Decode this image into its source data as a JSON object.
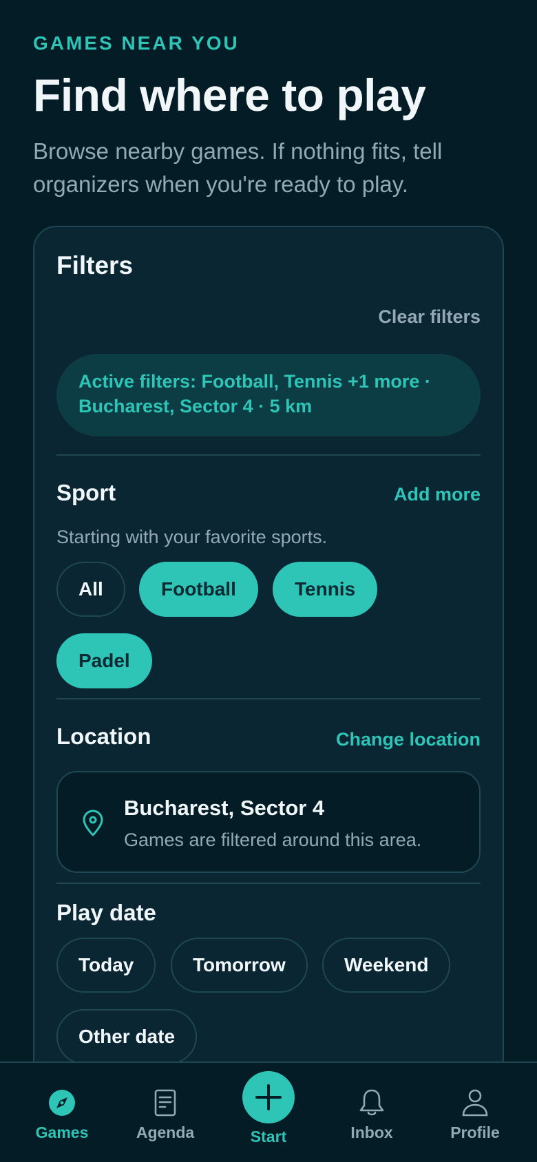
{
  "header": {
    "eyebrow": "GAMES NEAR YOU",
    "title": "Find where to play",
    "subtitle": "Browse nearby games. If nothing fits, tell organizers when you're ready to play."
  },
  "filters": {
    "title": "Filters",
    "clear_label": "Clear filters",
    "active_summary_line1": "Active filters: Football, Tennis +1 more ·",
    "active_summary_line2": "Bucharest, Sector 4 · 5 km"
  },
  "sport": {
    "title": "Sport",
    "action": "Add more",
    "helper": "Starting with your favorite sports.",
    "chips": [
      {
        "label": "All",
        "selected": false
      },
      {
        "label": "Football",
        "selected": true
      },
      {
        "label": "Tennis",
        "selected": true
      },
      {
        "label": "Padel",
        "selected": true
      }
    ]
  },
  "location": {
    "title": "Location",
    "action": "Change location",
    "name": "Bucharest, Sector 4",
    "description": "Games are filtered around this area.",
    "icon": "map-pin-icon"
  },
  "play_date": {
    "title": "Play date",
    "chips": [
      {
        "label": "Today",
        "selected": false
      },
      {
        "label": "Tomorrow",
        "selected": false
      },
      {
        "label": "Weekend",
        "selected": false
      },
      {
        "label": "Other date",
        "selected": false
      }
    ]
  },
  "nav": {
    "items": [
      {
        "label": "Games",
        "icon": "compass-icon",
        "active": true
      },
      {
        "label": "Agenda",
        "icon": "agenda-icon",
        "active": false
      },
      {
        "label": "Start",
        "icon": "plus-icon",
        "active": false
      },
      {
        "label": "Inbox",
        "icon": "bell-icon",
        "active": false
      },
      {
        "label": "Profile",
        "icon": "user-icon",
        "active": false
      }
    ]
  },
  "colors": {
    "background": "#031c26",
    "card": "#0a2633",
    "accent": "#2ec4b6",
    "text": "#f1f6f8",
    "muted": "#93aab4"
  }
}
